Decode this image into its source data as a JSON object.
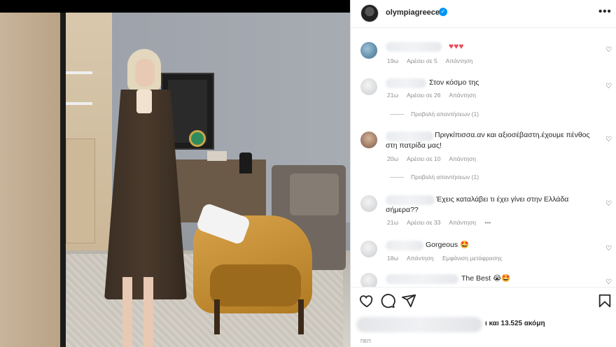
{
  "header": {
    "username": "olympiagreece",
    "verified_mark": "✓",
    "more_label": "•••"
  },
  "comments": [
    {
      "text": "",
      "emoji": "♥♥♥",
      "meta": {
        "time": "19ω",
        "likes": "Αρέσει σε 5",
        "reply": "Απάντηση"
      }
    },
    {
      "text": "Στον κόσμο της",
      "meta": {
        "time": "21ω",
        "likes": "Αρέσει σε 26",
        "reply": "Απάντηση"
      },
      "replies_label": "Προβολή απαντήσεων (1)"
    },
    {
      "text": "Πριγκίπισσα.αν και αξιοσέβαστη.έχουμε πένθος στη πατρίδα μας!",
      "meta": {
        "time": "20ω",
        "likes": "Αρέσει σε 10",
        "reply": "Απάντηση"
      },
      "replies_label": "Προβολή απαντήσεων (1)"
    },
    {
      "text": "Έχεις καταλάβει τι έχει γίνει στην Ελλάδα σήμερα??",
      "meta": {
        "time": "21ω",
        "likes": "Αρέσει σε 33",
        "reply": "Απάντηση",
        "more": "•••"
      }
    },
    {
      "text": "Gorgeous 🤩",
      "meta": {
        "time": "18ω",
        "reply": "Απάντηση",
        "translate": "Εμφάνιση μετάφρασης"
      }
    },
    {
      "text": "The Best 😭🤩"
    }
  ],
  "footer": {
    "likes_text": "ι και 13.525 ακόμη",
    "date_text": "ΠΕΠ"
  },
  "icons": {
    "like": "heart-icon",
    "comment": "comment-icon",
    "share": "share-icon",
    "save": "bookmark-icon"
  },
  "colors": {
    "verified": "#0095f6",
    "heart": "#ed4956",
    "meta": "#8e8e8e"
  }
}
